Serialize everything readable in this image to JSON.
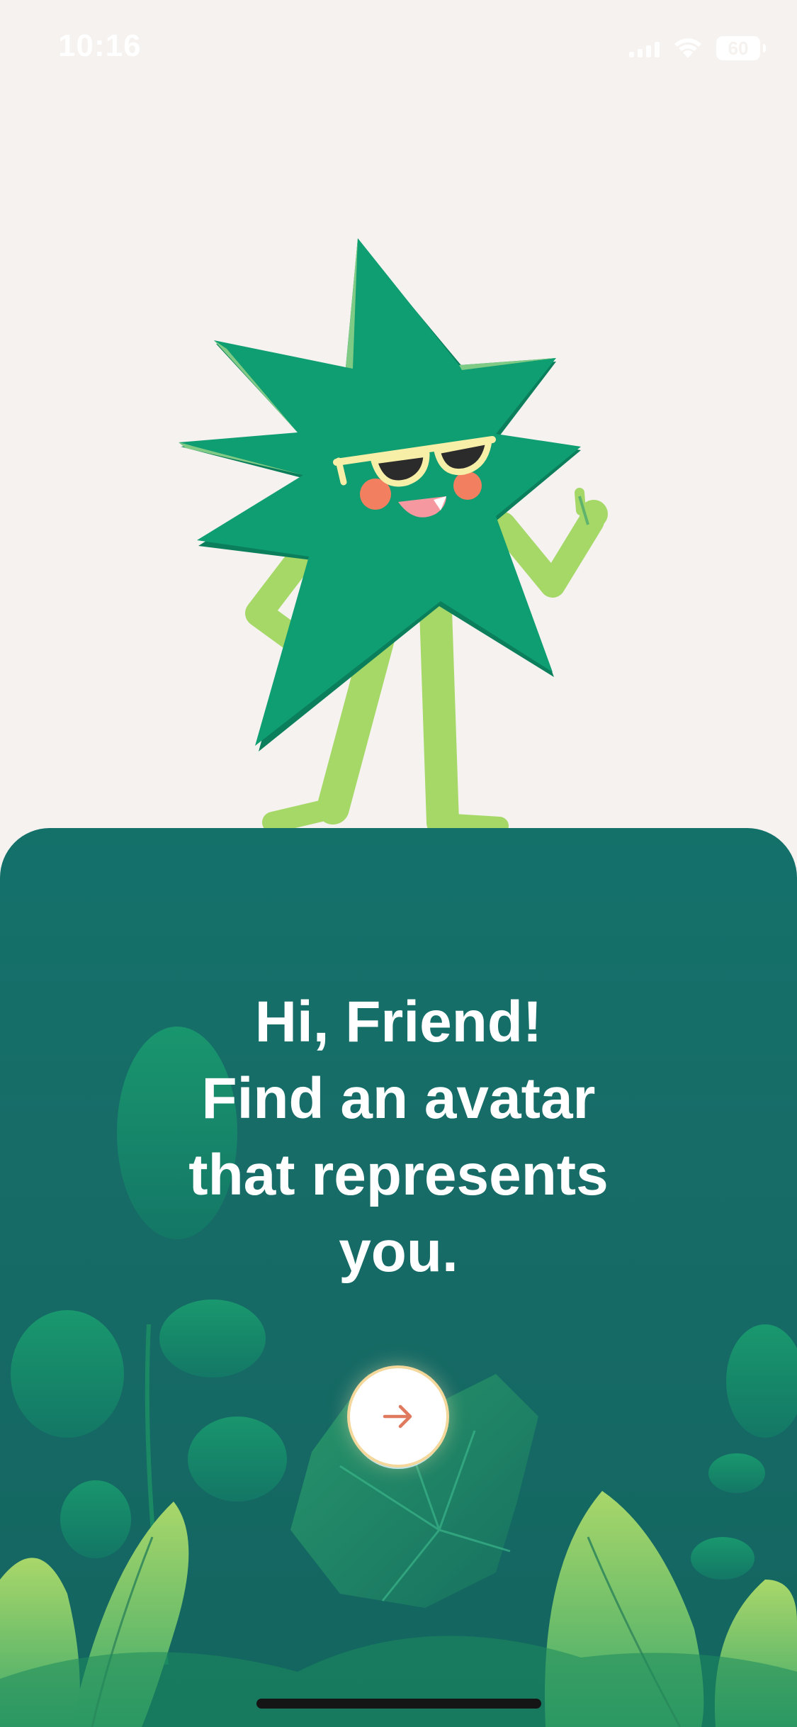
{
  "status_bar": {
    "time": "10:16",
    "battery": "60"
  },
  "onboarding": {
    "headline_lines": [
      "Hi, Friend!",
      "Find an avatar",
      "that represents",
      "you."
    ],
    "next_icon": "arrow-right-icon"
  },
  "colors": {
    "background": "#f5f2ef",
    "panel": "#14716a",
    "arrow": "#e07a5f",
    "star": "#0e9e72",
    "limbs": "#a6d868"
  }
}
